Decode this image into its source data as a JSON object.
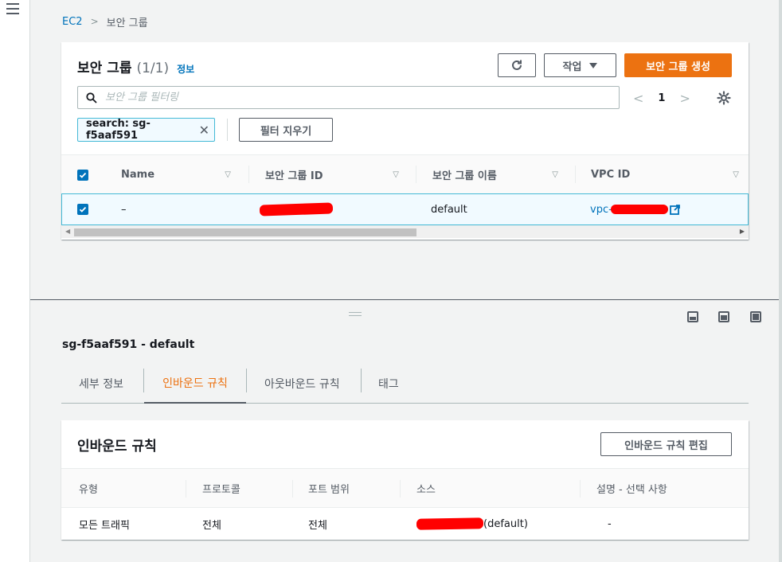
{
  "breadcrumb": {
    "root": "EC2",
    "separator": ">",
    "current": "보안 그룹"
  },
  "header": {
    "title": "보안 그룹",
    "count": "(1/1)",
    "info": "정보",
    "action_label": "작업",
    "create_label": "보안 그룹 생성",
    "refresh_icon": "refresh-icon"
  },
  "search": {
    "placeholder": "보안 그룹 필터링",
    "value": ""
  },
  "pagination": {
    "current_page": "1",
    "prev": "<",
    "next": ">"
  },
  "filter_token": {
    "label": "search: sg-f5aaf591",
    "remove": "✕"
  },
  "clear_filters_label": "필터 지우기",
  "table": {
    "columns": [
      "Name",
      "보안 그룹 ID",
      "보안 그룹 이름",
      "VPC ID"
    ],
    "rows": [
      {
        "name": "–",
        "group_id": "",
        "group_name": "default",
        "vpc_id": "vpc-"
      }
    ]
  },
  "detail": {
    "title": "sg-f5aaf591 - default",
    "tabs": [
      "세부 정보",
      "인바운드 규칙",
      "아웃바운드 규칙",
      "태그"
    ],
    "active_tab": 1
  },
  "inbound": {
    "title": "인바운드 규칙",
    "edit_label": "인바운드 규칙 편집",
    "columns": [
      "유형",
      "프로토콜",
      "포트 범위",
      "소스",
      "설명 - 선택 사항"
    ],
    "rows": [
      {
        "type": "모든 트래픽",
        "protocol": "전체",
        "port_range": "전체",
        "source_suffix": "(default)",
        "description": "-"
      }
    ]
  },
  "colors": {
    "accent": "#ec7211",
    "link": "#0073bb",
    "selected_bg": "#f1faff",
    "selected_border": "#44b9d6",
    "redaction": "#ff0000"
  }
}
